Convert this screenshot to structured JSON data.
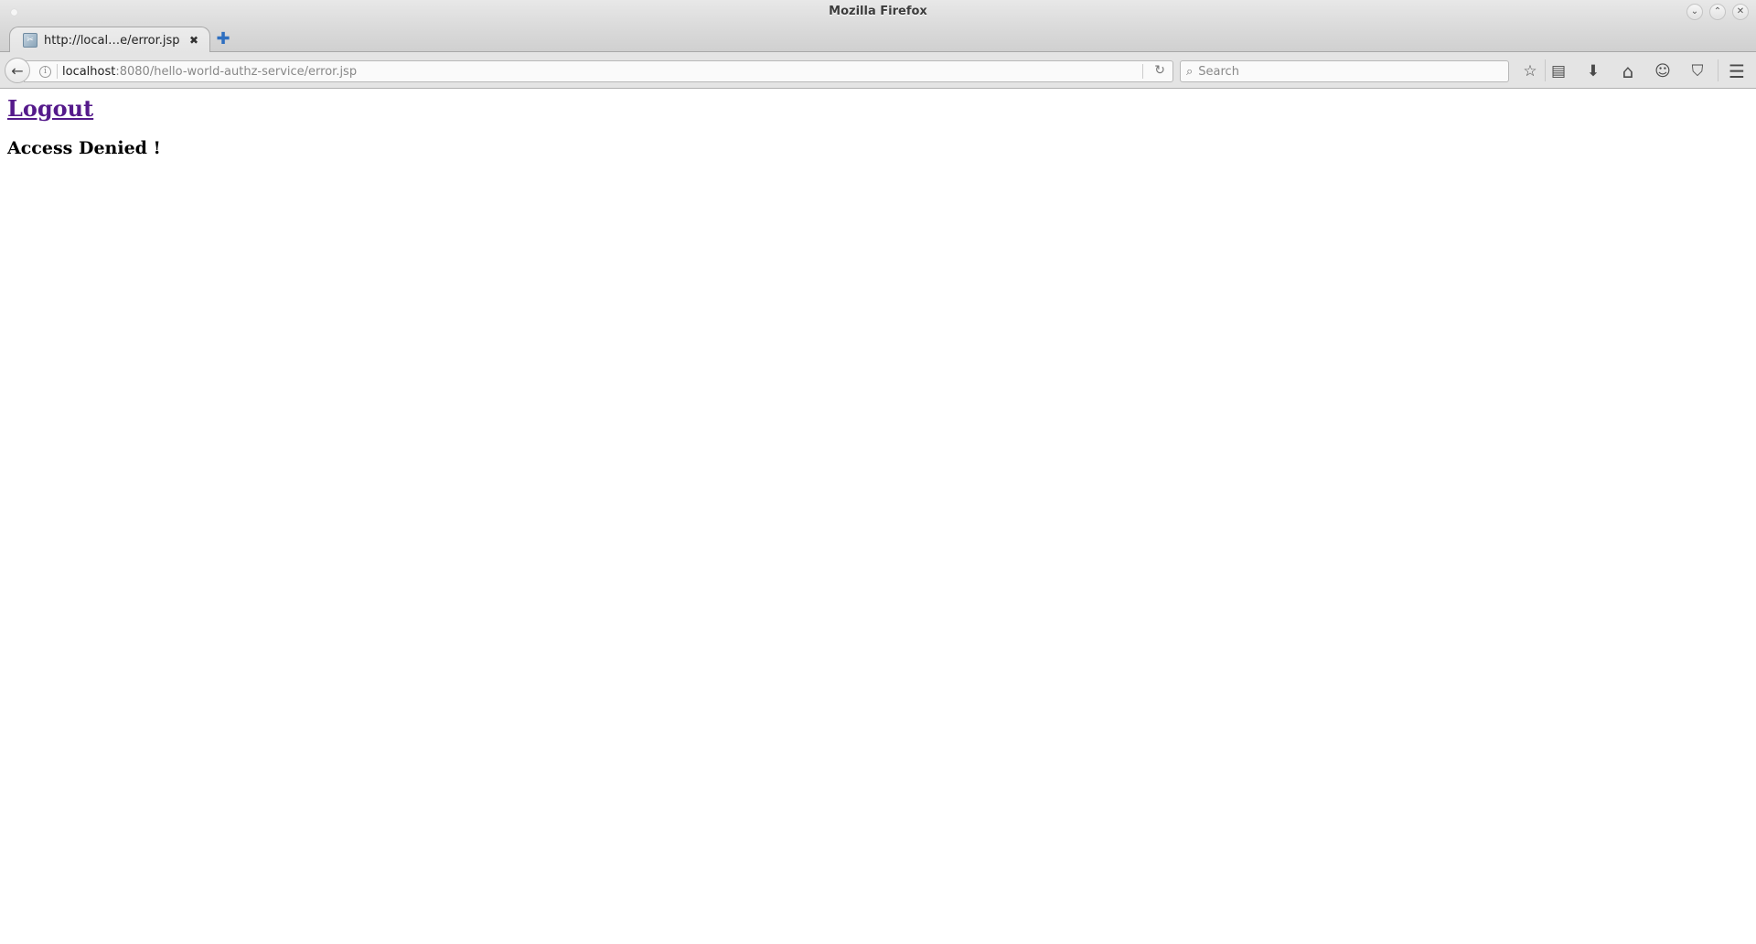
{
  "window": {
    "title": "Mozilla Firefox",
    "controls": {
      "minimize": "⌄",
      "maximize": "⌃",
      "close": "✕"
    }
  },
  "tabs": [
    {
      "title": "http://local…e/error.jsp",
      "active": true,
      "favicon": "broken-page-icon",
      "close": "✖"
    }
  ],
  "new_tab": "✚",
  "navbar": {
    "back": "🡐",
    "info": "i",
    "url_host": "localhost",
    "url_rest": ":8080/hello-world-authz-service/error.jsp",
    "reload": "↻",
    "search_placeholder": "Search",
    "search_value": "",
    "search_glyph": "🔍",
    "toolbar_icons": [
      {
        "name": "bookmark-star-icon",
        "glyph": "☆"
      },
      {
        "name": "reading-list-icon",
        "glyph": "▤"
      },
      {
        "name": "download-icon",
        "glyph": "⬇"
      },
      {
        "name": "home-icon",
        "glyph": "⌂"
      },
      {
        "name": "hello-chat-icon",
        "glyph": "☺"
      },
      {
        "name": "pocket-icon",
        "glyph": "⛉"
      },
      {
        "name": "menu-icon",
        "glyph": "☰"
      }
    ]
  },
  "page": {
    "logout_link": "Logout",
    "message": "Access Denied !"
  },
  "colors": {
    "visited_link": "#551a8b",
    "new_tab_accent": "#2e6fc0"
  }
}
